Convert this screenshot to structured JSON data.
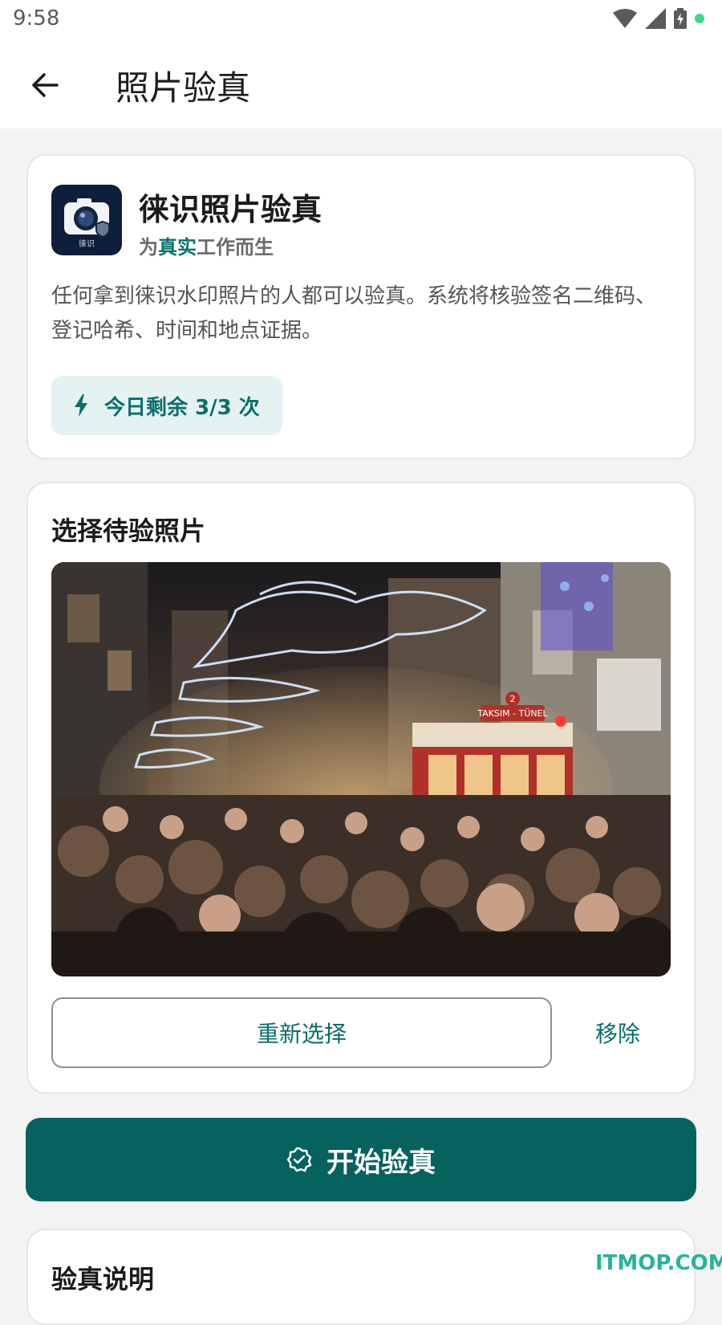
{
  "status_bar": {
    "time": "9:58"
  },
  "app_bar": {
    "title": "照片验真"
  },
  "intro_card": {
    "app_icon_label": "徕识",
    "app_name": "徕识照片验真",
    "tagline_prefix": "为",
    "tagline_highlight": "真实",
    "tagline_suffix": "工作而生",
    "description": "任何拿到徕识水印照片的人都可以验真。系统将核验签名二维码、登记哈希、时间和地点证据。",
    "quota_text": "今日剩余 3/3 次"
  },
  "select_card": {
    "title": "选择待验照片",
    "reselect_label": "重新选择",
    "remove_label": "移除",
    "photo_sign_route": "TAKSIM - TÜNEL",
    "photo_sign_number": "2"
  },
  "primary_action": {
    "label": "开始验真"
  },
  "info_card": {
    "title": "验真说明"
  },
  "watermark": "ITMOP.COM",
  "colors": {
    "accent": "#05625f",
    "accent_text": "#0a6d6a",
    "quota_bg": "#e4f3f2"
  },
  "icons": [
    "back-arrow-icon",
    "wifi-icon",
    "signal-icon",
    "battery-icon",
    "camera-shield-icon",
    "lightning-icon",
    "badge-check-icon"
  ]
}
